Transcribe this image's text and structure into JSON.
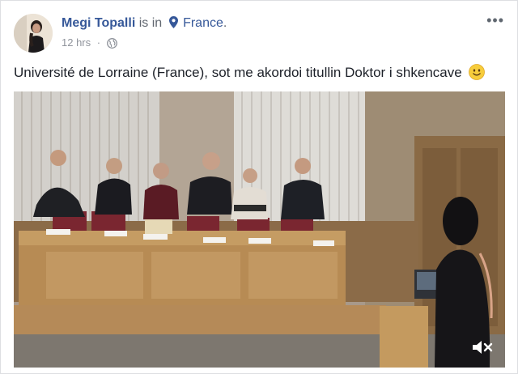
{
  "post": {
    "author": "Megi Topalli",
    "is_in": "is in",
    "location": "France",
    "location_suffix": ".",
    "time": "12 hrs",
    "separator": "·",
    "more_label": "•••",
    "caption": "Université de Lorraine (France), sot me akordoi titullin Doktor i shkencave",
    "caption_emoji": "smile-emoji",
    "video": {
      "icons": [
        "mute-icon"
      ]
    }
  },
  "colors": {
    "link": "#365899",
    "meta": "#90949c",
    "text": "#1d2129"
  }
}
